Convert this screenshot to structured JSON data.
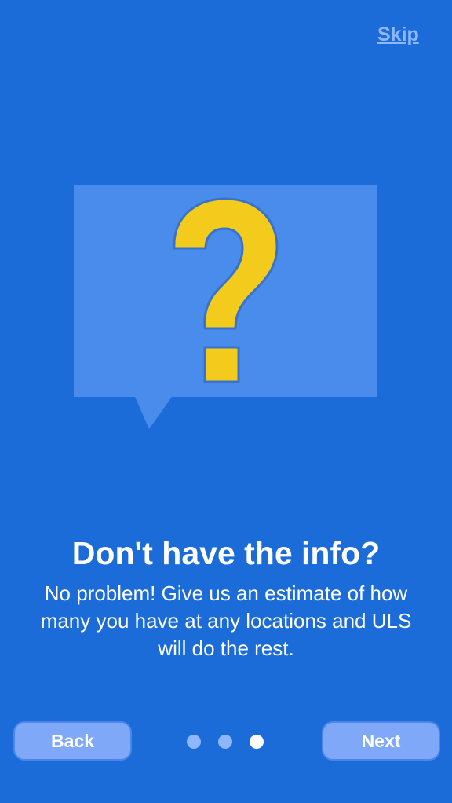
{
  "header": {
    "skip_label": "Skip"
  },
  "illustration": {
    "icon": "question-mark-speech-bubble-icon",
    "bubble_color": "#4a8cec",
    "glyph_color": "#f2cb1d"
  },
  "content": {
    "title": "Don't have the info?",
    "body": "No problem! Give us an estimate of how many you have at any locations and ULS will do the rest."
  },
  "footer": {
    "back_label": "Back",
    "next_label": "Next",
    "pagination": {
      "total": 3,
      "current": 3
    }
  },
  "colors": {
    "background": "#1b6cd9",
    "button": "#7fa8f8",
    "dot_inactive": "#8fb6ff",
    "dot_active": "#ffffff"
  }
}
